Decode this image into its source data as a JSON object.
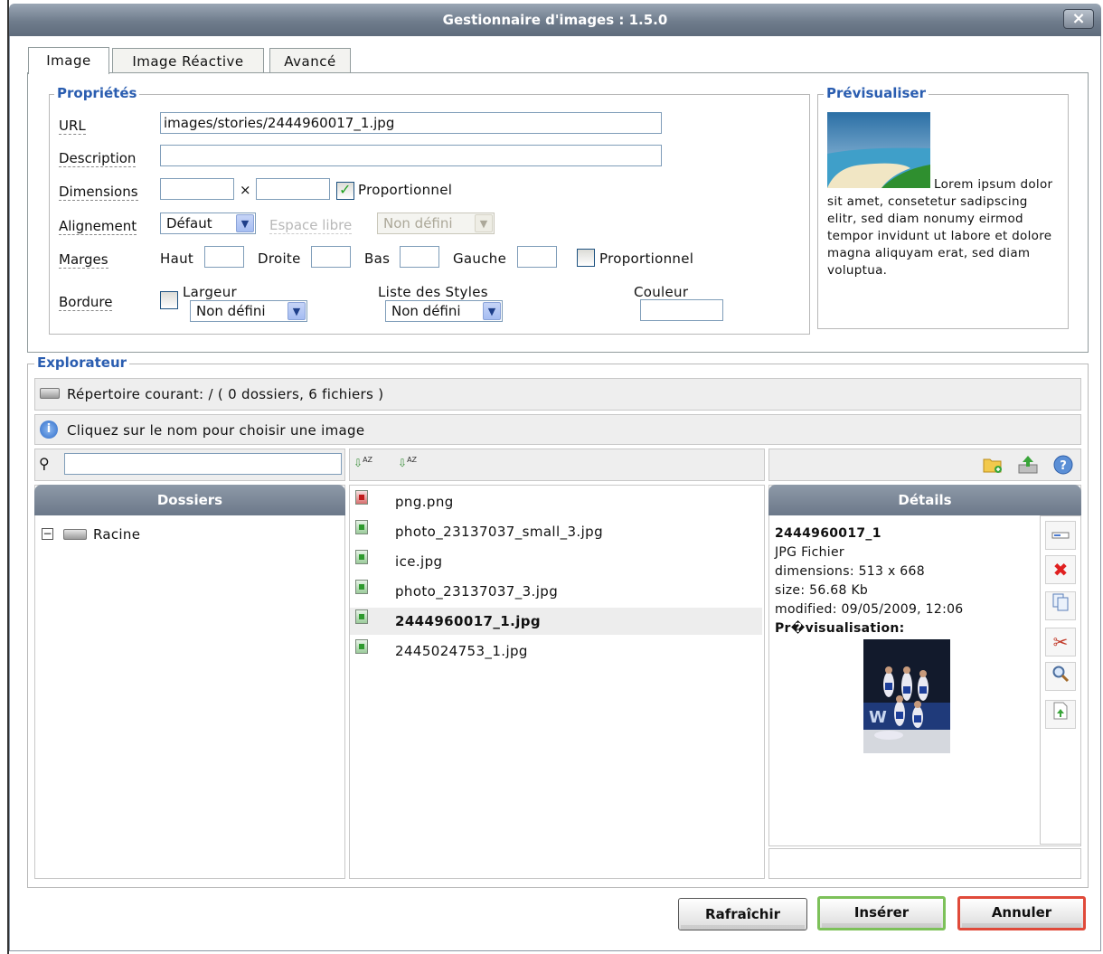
{
  "window": {
    "title": "Gestionnaire d'images : 1.5.0",
    "close_label": "×"
  },
  "tabs": [
    {
      "label": "Image"
    },
    {
      "label": "Image Réactive"
    },
    {
      "label": "Avancé"
    }
  ],
  "properties": {
    "legend": "Propriétés",
    "url_label": "URL",
    "url_value": "images/stories/2444960017_1.jpg",
    "description_label": "Description",
    "description_value": "",
    "dimensions_label": "Dimensions",
    "dimensions_sep": "×",
    "width_value": "",
    "height_value": "",
    "proportional_label": "Proportionnel",
    "proportional_checked": true,
    "alignment_label": "Alignement",
    "alignment_value": "Défaut",
    "free_space_label": "Espace libre",
    "free_space_value": "Non défini",
    "margins_label": "Marges",
    "margin_top_label": "Haut",
    "margin_right_label": "Droite",
    "margin_bottom_label": "Bas",
    "margin_left_label": "Gauche",
    "margins_proportional_label": "Proportionnel",
    "margins_proportional_checked": false,
    "border_label": "Bordure",
    "border_checked": false,
    "border_width_label": "Largeur",
    "border_width_value": "Non défini",
    "styles_label": "Liste des Styles",
    "styles_value": "Non défini",
    "color_label": "Couleur",
    "color_value": ""
  },
  "preview": {
    "legend": "Prévisualiser",
    "text": "Lorem ipsum dolor sit amet, consetetur sadipscing elitr, sed diam nonumy eirmod tempor invidunt ut labore et dolore magna aliquyam erat, sed diam voluptua."
  },
  "explorer": {
    "legend": "Explorateur",
    "current_dir": "Répertoire courant: / ( 0 dossiers, 6 fichiers )",
    "info": "Cliquez sur le nom pour choisir une image",
    "search_value": "",
    "folders_header": "Dossiers",
    "root_label": "Racine",
    "files": [
      {
        "name": "png.png",
        "type": "png"
      },
      {
        "name": "photo_23137037_small_3.jpg",
        "type": "jpg"
      },
      {
        "name": "ice.jpg",
        "type": "jpg"
      },
      {
        "name": "photo_23137037_3.jpg",
        "type": "jpg"
      },
      {
        "name": "2444960017_1.jpg",
        "type": "jpg",
        "selected": true
      },
      {
        "name": "2445024753_1.jpg",
        "type": "jpg"
      }
    ],
    "details_header": "Détails",
    "details": {
      "name": "2444960017_1",
      "type": "JPG Fichier",
      "dimensions": "dimensions: 513 x 668",
      "size": "size: 56.68 Kb",
      "modified": "modified: 09/05/2009, 12:06",
      "preview_label": "Pr�visualisation:"
    }
  },
  "buttons": {
    "refresh": "Rafraîchir",
    "insert": "Insérer",
    "cancel": "Annuler"
  },
  "colors": {
    "legend": "#2a5db0",
    "header": "#7b8796",
    "insert_border": "#7dc15a",
    "cancel_border": "#e04a3a"
  }
}
